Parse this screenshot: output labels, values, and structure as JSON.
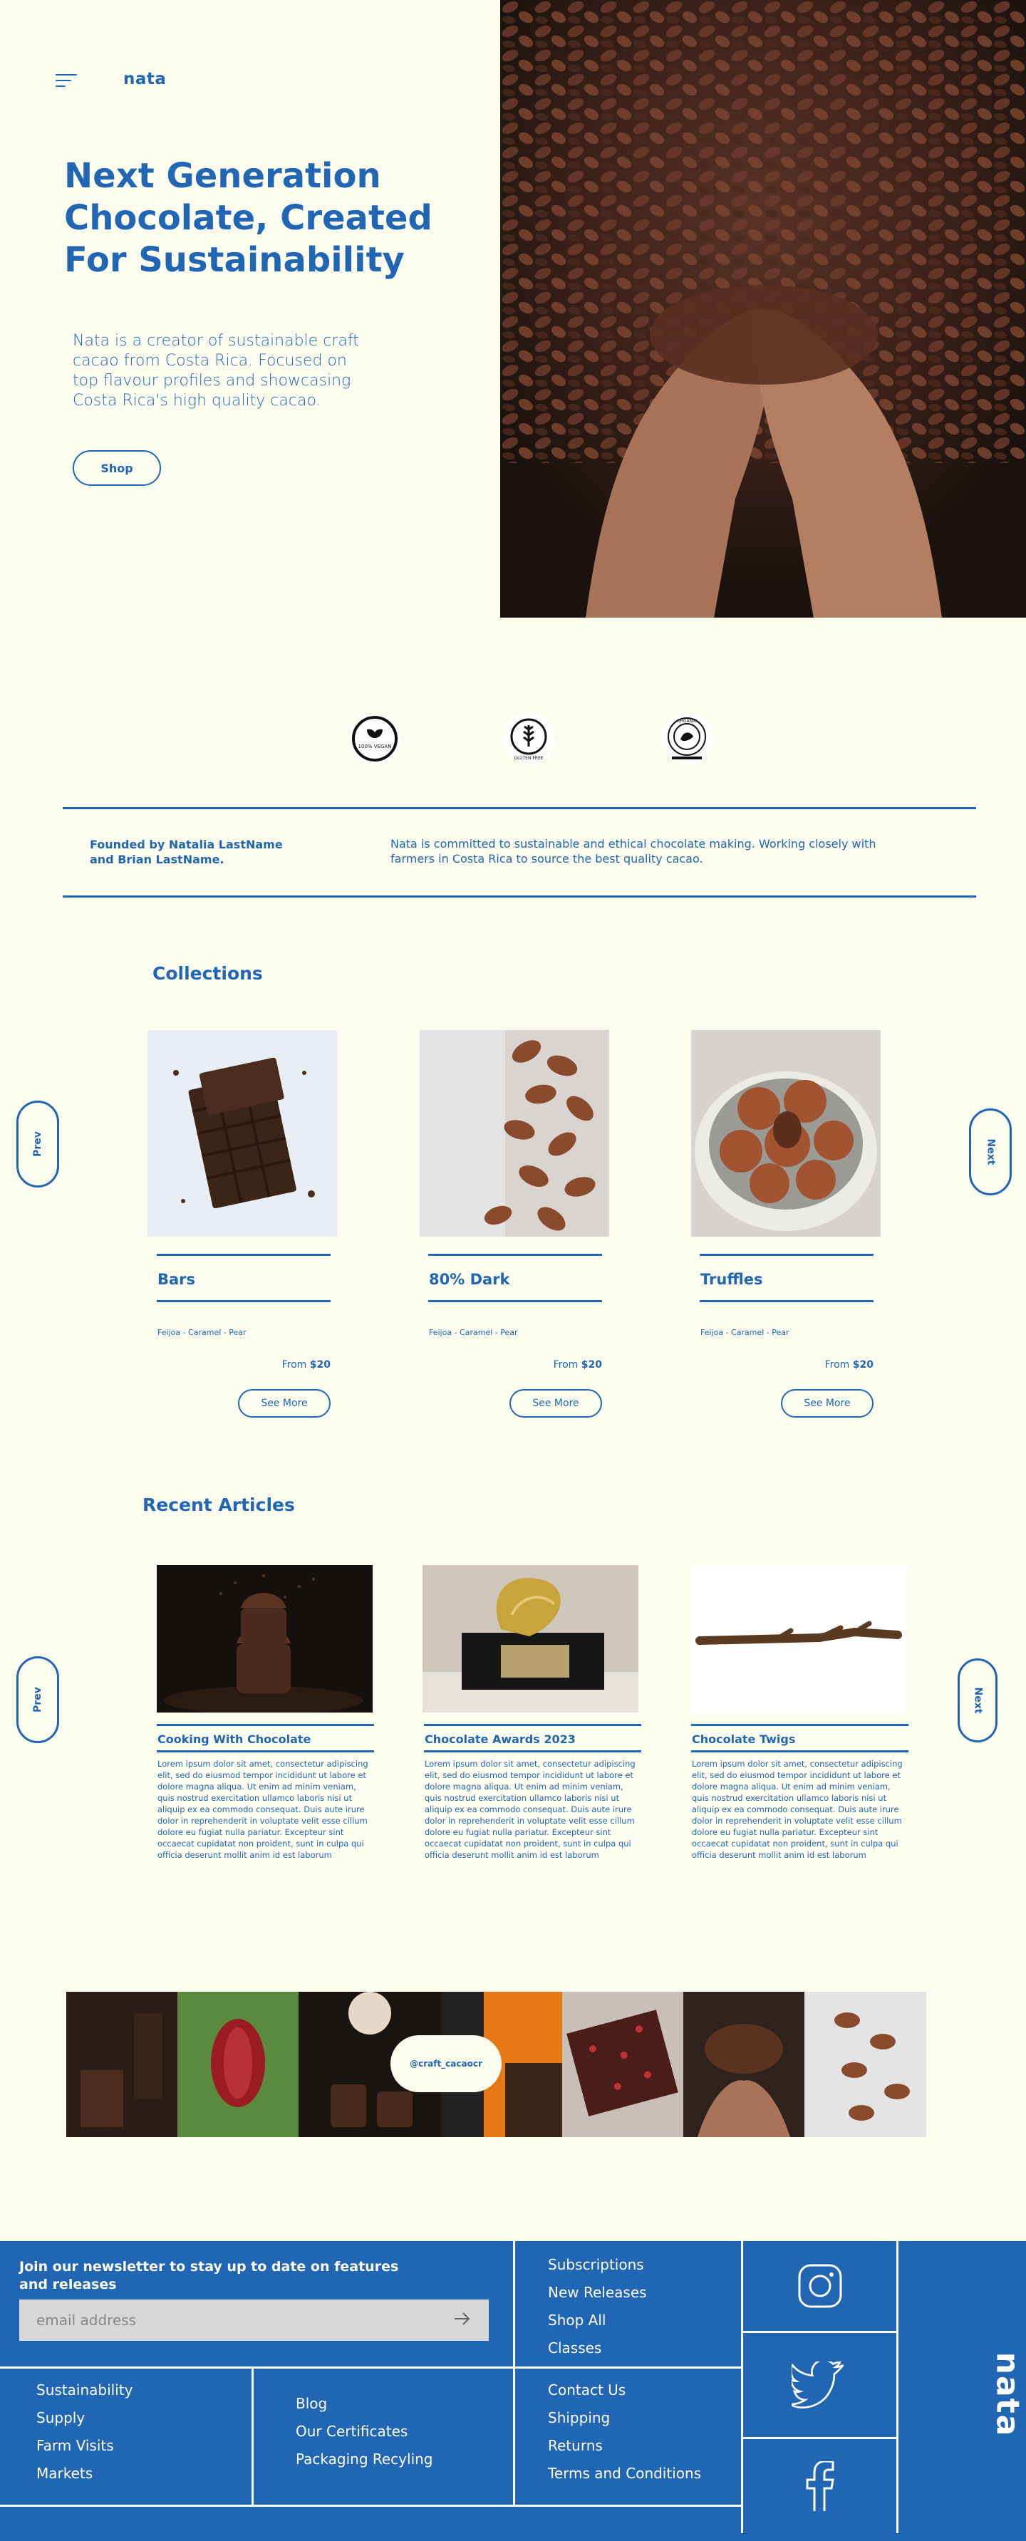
{
  "header": {
    "logo": "nata"
  },
  "hero": {
    "title": "Next Generation Chocolate, Created For Sustainability",
    "description": "Nata is a creator of sustainable craft cacao from Costa Rica. Focused on top flavour profiles and showcasing Costa Rica's high quality cacao.",
    "shop_label": "Shop"
  },
  "badges": {
    "vegan_text": "100% VEGAN",
    "gluten_text": "GLUTEN FREE",
    "organic_text": "ORGANIC"
  },
  "about": {
    "founders": "Founded by Natalia LastName and Brian LastName.",
    "mission": "Nata is committed to sustainable and ethical chocolate making. Working closely with farmers in Costa Rica to source the best quality cacao."
  },
  "collections": {
    "title": "Collections",
    "prev_label": "Prev",
    "next_label": "Next",
    "items": [
      {
        "name": "Bars",
        "flavours": "Feijoa - Caramel - Pear",
        "price_prefix": "From ",
        "price": "$20",
        "button": "See More"
      },
      {
        "name": "80% Dark",
        "flavours": "Feijoa - Caramel - Pear",
        "price_prefix": "From ",
        "price": "$20",
        "button": "See More"
      },
      {
        "name": "Truffles",
        "flavours": "Feijoa - Caramel - Pear",
        "price_prefix": "From ",
        "price": "$20",
        "button": "See More"
      }
    ]
  },
  "articles": {
    "title": "Recent Articles",
    "prev_label": "Prev",
    "next_label": "Next",
    "items": [
      {
        "title": "Cooking With Chocolate",
        "body": "Lorem ipsum dolor sit amet, consectetur adipiscing elit, sed do eiusmod tempor incididunt ut labore et dolore magna aliqua. Ut enim ad minim veniam, quis nostrud exercitation ullamco laboris nisi ut aliquip ex ea commodo consequat. Duis aute irure dolor in reprehenderit in voluptate velit esse cillum dolore eu fugiat nulla pariatur. Excepteur sint occaecat cupidatat non proident, sunt in culpa qui officia deserunt mollit anim id est laborum"
      },
      {
        "title": "Chocolate Awards 2023",
        "body": "Lorem ipsum dolor sit amet, consectetur adipiscing elit, sed do eiusmod tempor incididunt ut labore et dolore magna aliqua. Ut enim ad minim veniam, quis nostrud exercitation ullamco laboris nisi ut aliquip ex ea commodo consequat. Duis aute irure dolor in reprehenderit in voluptate velit esse cillum dolore eu fugiat nulla pariatur. Excepteur sint occaecat cupidatat non proident, sunt in culpa qui officia deserunt mollit anim id est laborum"
      },
      {
        "title": "Chocolate Twigs",
        "body": "Lorem ipsum dolor sit amet, consectetur adipiscing elit, sed do eiusmod tempor incididunt ut labore et dolore magna aliqua. Ut enim ad minim veniam, quis nostrud exercitation ullamco laboris nisi ut aliquip ex ea commodo consequat. Duis aute irure dolor in reprehenderit in voluptate velit esse cillum dolore eu fugiat nulla pariatur. Excepteur sint occaecat cupidatat non proident, sunt in culpa qui officia deserunt mollit anim id est laborum"
      }
    ]
  },
  "instagram": {
    "handle": "@craft_cacaocr"
  },
  "footer": {
    "newsletter": "Join our newsletter to stay up to date on features and releases",
    "email_placeholder": "email address",
    "col_shop": [
      "Subscriptions",
      "New Releases",
      "Shop All",
      "Classes"
    ],
    "col_company": [
      "Sustainability",
      "Supply",
      "Farm Visits",
      "Markets"
    ],
    "col_info": [
      "Blog",
      "Our Certificates",
      "Packaging Recyling"
    ],
    "col_help": [
      "Contact Us",
      "Shipping",
      "Returns",
      "Terms and Conditions"
    ],
    "logo": "nata"
  },
  "colors": {
    "brand_blue": "#2166B5",
    "background": "#FDFDEF",
    "input_gray": "#D8D8D8"
  }
}
